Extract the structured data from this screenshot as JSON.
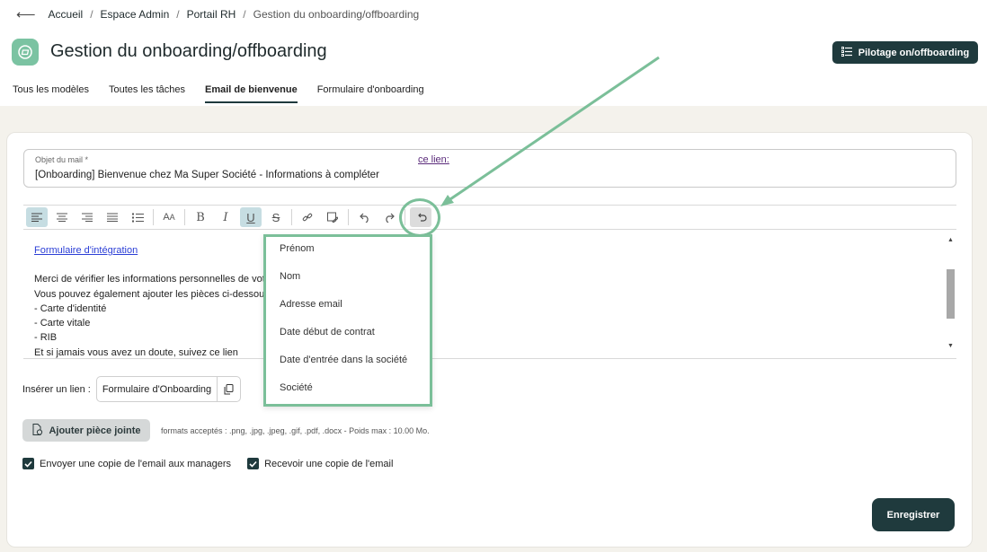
{
  "breadcrumb": {
    "back": "⟵",
    "items": [
      "Accueil",
      "Espace Admin",
      "Portail RH",
      "Gestion du onboarding/offboarding"
    ]
  },
  "header": {
    "title": "Gestion du onboarding/offboarding",
    "icon": "folder-icon",
    "action_label": "Pilotage on/offboarding"
  },
  "tabs": [
    {
      "label": "Tous les modèles",
      "active": false
    },
    {
      "label": "Toutes les tâches",
      "active": false
    },
    {
      "label": "Email de bienvenue",
      "active": true
    },
    {
      "label": "Formulaire d'onboarding",
      "active": false
    }
  ],
  "subject": {
    "label": "Objet du mail *",
    "value": "[Onboarding] Bienvenue chez Ma Super Société - Informations à compléter"
  },
  "toolbar": {
    "buttons": [
      "align-left",
      "align-center",
      "align-right",
      "align-justify",
      "list",
      "font-size",
      "bold",
      "italic",
      "underline",
      "strikethrough",
      "link",
      "image",
      "undo",
      "redo",
      "insert-variable"
    ]
  },
  "editor": {
    "link_text": "Formulaire d'intégration",
    "lines": [
      "Merci de vérifier les informations personnelles de vot",
      "Vous pouvez également ajouter les pièces ci-dessous",
      "- Carte d'identité",
      "- Carte vitale",
      "- RIB",
      "Et si jamais vous avez un doute, suivez ce lien"
    ],
    "link_tail": "ce lien:"
  },
  "variables_menu": {
    "options": [
      "Prénom",
      "Nom",
      "Adresse email",
      "Date début de contrat",
      "Date d'entrée dans la société",
      "Société"
    ]
  },
  "insert_link": {
    "label": "Insérer un lien :",
    "value": "Formulaire d'Onboarding"
  },
  "attachment": {
    "button_label": "Ajouter pièce jointe",
    "formats": "formats acceptés : .png, .jpg, .jpeg, .gif, .pdf, .docx - Poids max : 10.00 Mo."
  },
  "checkboxes": [
    {
      "label": "Envoyer une copie de l'email aux managers",
      "checked": true
    },
    {
      "label": "Recevoir une copie de l'email",
      "checked": true
    }
  ],
  "save_label": "Enregistrer",
  "colors": {
    "primary": "#1f3a3d",
    "accent": "#7bbf99",
    "background": "#f4f2ec"
  }
}
